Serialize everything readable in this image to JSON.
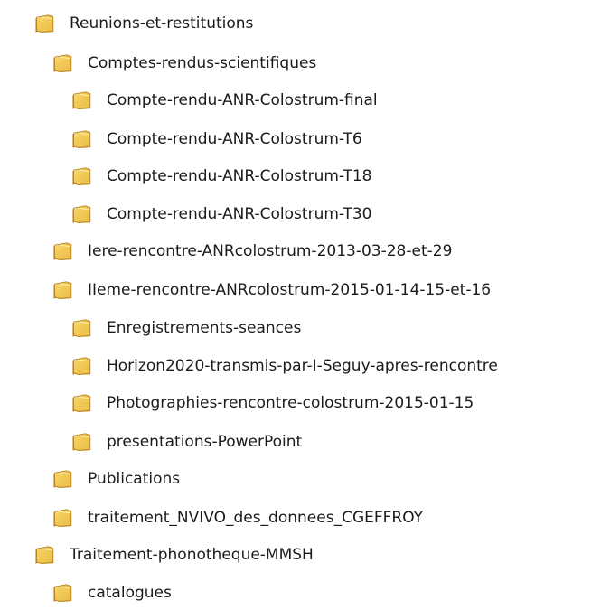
{
  "folder_tree": {
    "icon": "folder-icon",
    "icon_color": "#e5b845",
    "items": [
      {
        "label": "Reunions-et-restitutions",
        "depth": 0
      },
      {
        "label": "Comptes-rendus-scientifiques",
        "depth": 1
      },
      {
        "label": "Compte-rendu-ANR-Colostrum-final",
        "depth": 2
      },
      {
        "label": "Compte-rendu-ANR-Colostrum-T6",
        "depth": 2
      },
      {
        "label": "Compte-rendu-ANR-Colostrum-T18",
        "depth": 2
      },
      {
        "label": "Compte-rendu-ANR-Colostrum-T30",
        "depth": 2
      },
      {
        "label": "Iere-rencontre-ANRcolostrum-2013-03-28-et-29",
        "depth": 1
      },
      {
        "label": "IIeme-rencontre-ANRcolostrum-2015-01-14-15-et-16",
        "depth": 1
      },
      {
        "label": "Enregistrements-seances",
        "depth": 2
      },
      {
        "label": "Horizon2020-transmis-par-I-Seguy-apres-rencontre",
        "depth": 2
      },
      {
        "label": "Photographies-rencontre-colostrum-2015-01-15",
        "depth": 2
      },
      {
        "label": "presentations-PowerPoint",
        "depth": 2
      },
      {
        "label": "Publications",
        "depth": 1
      },
      {
        "label": "traitement_NVIVO_des_donnees_CGEFFROY",
        "depth": 1
      },
      {
        "label": "Traitement-phonotheque-MMSH",
        "depth": 0
      },
      {
        "label": "catalogues",
        "depth": 1
      }
    ]
  }
}
